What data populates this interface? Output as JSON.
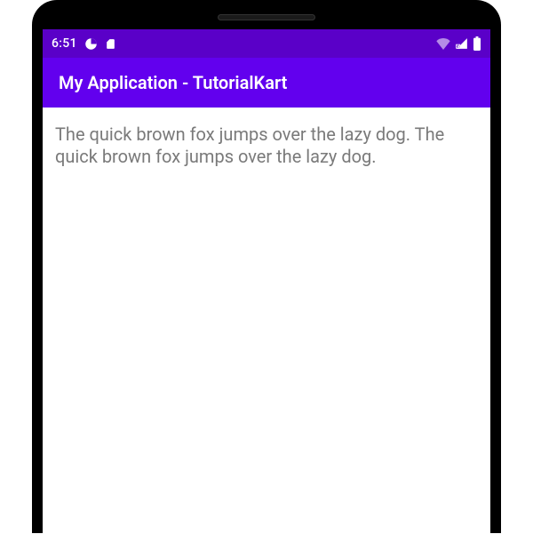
{
  "statusBar": {
    "time": "6:51"
  },
  "appBar": {
    "title": "My Application - TutorialKart"
  },
  "content": {
    "bodyText": "The quick brown fox jumps over the lazy dog. The quick brown fox jumps over the lazy dog."
  }
}
